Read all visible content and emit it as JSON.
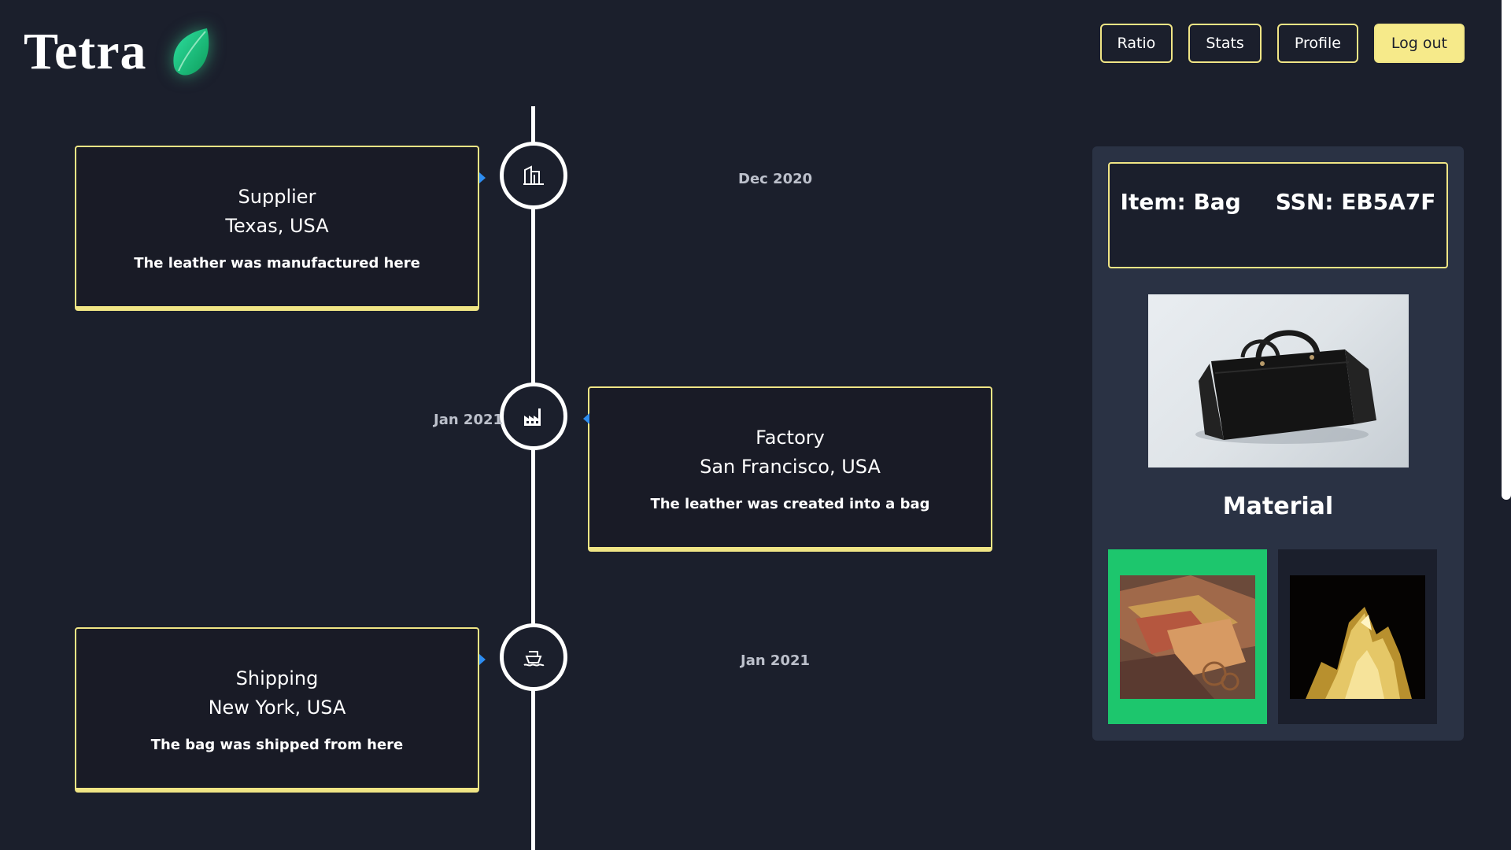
{
  "app": {
    "title": "Tetra"
  },
  "nav": {
    "ratio": "Ratio",
    "stats": "Stats",
    "profile": "Profile",
    "logout": "Log out"
  },
  "timeline": [
    {
      "title": "Supplier",
      "place": "Texas, USA",
      "desc": "The leather was manufactured here",
      "date": "Dec 2020",
      "icon": "building-icon"
    },
    {
      "title": "Factory",
      "place": "San Francisco, USA",
      "desc": "The leather was created into a bag",
      "date": "Jan 2021",
      "icon": "factory-icon"
    },
    {
      "title": "Shipping",
      "place": "New York, USA",
      "desc": "The bag was shipped from here",
      "date": "Jan 2021",
      "icon": "ship-icon"
    }
  ],
  "item": {
    "name": "Item: Bag",
    "ssn": "SSN: EB5A7F"
  },
  "material": {
    "title": "Material",
    "options": [
      "leather",
      "gold"
    ],
    "selected": "leather"
  },
  "colors": {
    "accent": "#f0e585",
    "background": "#1b1f2c",
    "panel": "#2a3244",
    "selected": "#1dc66d"
  }
}
